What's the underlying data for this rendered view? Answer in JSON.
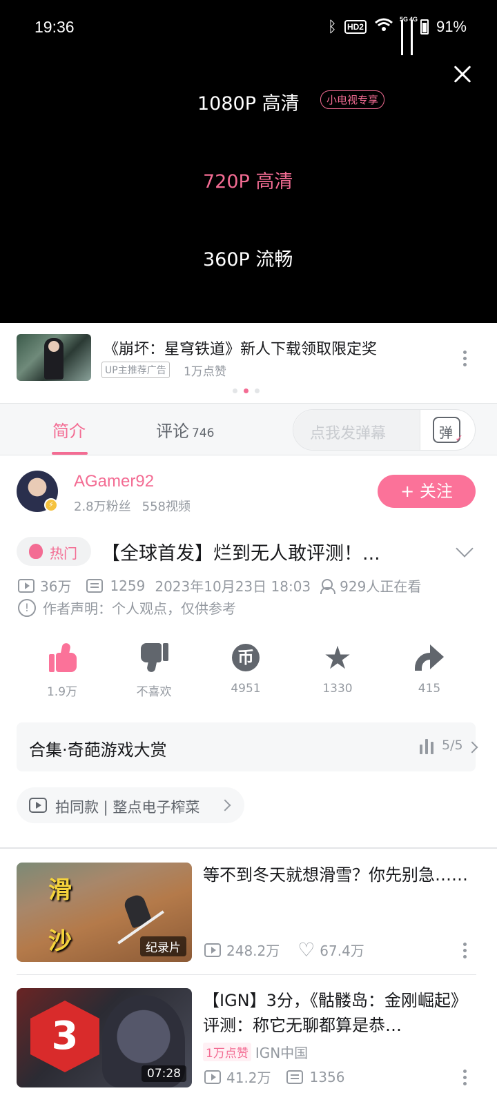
{
  "status_bar": {
    "time": "19:36",
    "battery": "91%",
    "net1": "5G",
    "net2": "4G",
    "hd": "HD2"
  },
  "quality_panel": {
    "options": [
      {
        "label": "1080P 高清",
        "badge": "小电视专享",
        "selected": false
      },
      {
        "label": "720P 高清",
        "selected": true
      },
      {
        "label": "360P 流畅",
        "selected": false
      }
    ]
  },
  "ad": {
    "title": "《崩坏：星穹铁道》新人下载领取限定奖",
    "tag": "UP主推荐广告",
    "likes": "1万点赞"
  },
  "tabs": {
    "intro": "简介",
    "comments": "评论",
    "comment_count": "746",
    "danmaku_placeholder": "点我发弹幕",
    "danmaku_btn": "弹"
  },
  "uploader": {
    "name": "AGamer92",
    "fans": "2.8万粉丝",
    "videos": "558视频",
    "follow": "+ 关注"
  },
  "video": {
    "hot_tag": "热门",
    "title": "【全球首发】烂到无人敢评测！...",
    "views": "36万",
    "danmaku": "1259",
    "date": "2023年10月23日 18:03",
    "watching": "929人正在看",
    "declaration": "作者声明：个人观点，仅供参考"
  },
  "actions": {
    "like": "1.9万",
    "dislike": "不喜欢",
    "coin": "4951",
    "favorite": "1330",
    "share": "415"
  },
  "collection": {
    "title": "合集·奇葩游戏大赏",
    "progress": "5/5"
  },
  "same_style": "拍同款 | 整点电子榨菜",
  "recommendations": [
    {
      "title": "等不到冬天就想滑雪？你先别急……",
      "thumb_text_1": "滑",
      "thumb_text_2": "沙",
      "badge": "纪录片",
      "views": "248.2万",
      "likes": "67.4万"
    },
    {
      "title": "【IGN】3分，《骷髅岛：金刚崛起》评测：称它无聊都算是恭…",
      "thumb_text": "3",
      "duration": "07:28",
      "like_tag": "1万点赞",
      "author": "IGN中国",
      "views": "41.2万",
      "danmaku": "1356"
    }
  ],
  "colors": {
    "accent": "#fb7299",
    "accent_text": "#f36c93",
    "secondary_text": "#9499a0"
  }
}
